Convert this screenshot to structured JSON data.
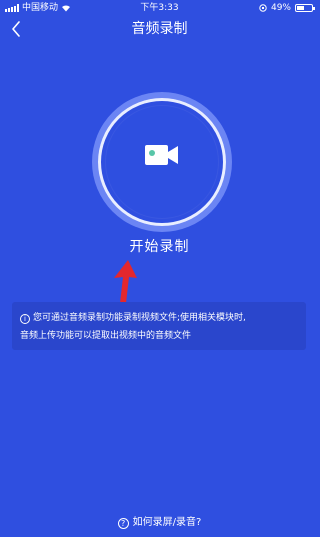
{
  "status_bar": {
    "carrier": "中国移动",
    "time": "下午3:33",
    "battery": "49%",
    "battery_level": 0.49
  },
  "nav": {
    "title": "音频录制"
  },
  "record": {
    "button_label": "开始录制"
  },
  "info": {
    "line1": "您可通过音频录制功能录制视频文件;使用相关模块时,",
    "line2": "音频上传功能可以提取出视频中的音频文件"
  },
  "help": {
    "label": "如何录屏/录音?"
  },
  "colors": {
    "background": "#2f4fe0",
    "arrow": "#e3272d"
  }
}
